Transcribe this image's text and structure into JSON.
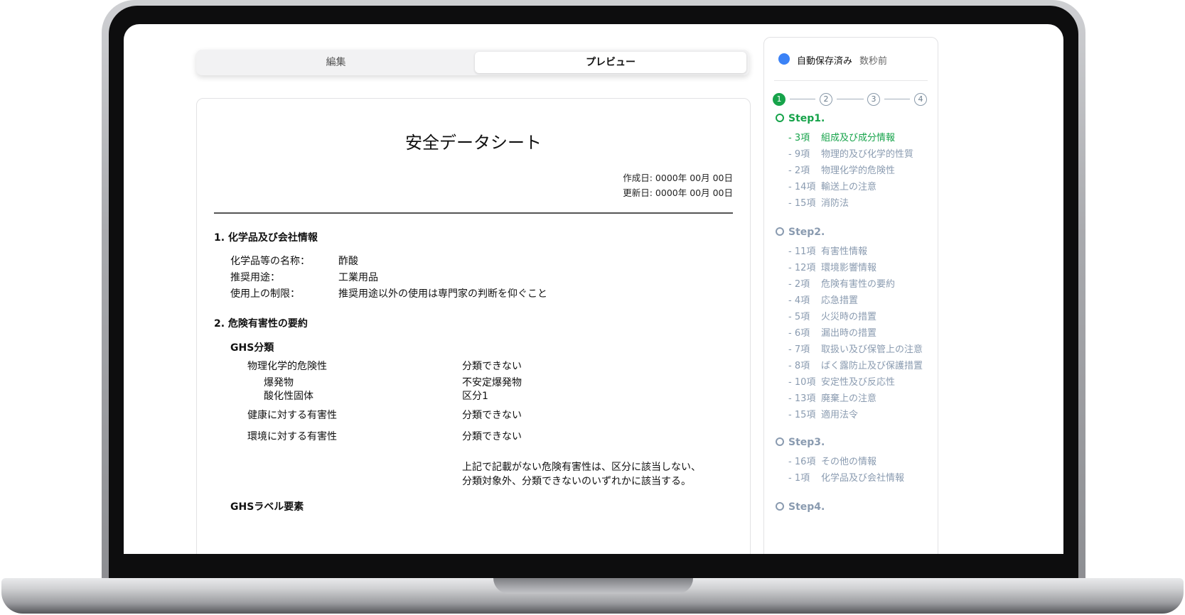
{
  "tabs": [
    {
      "label": "編集"
    },
    {
      "label": "プレビュー"
    }
  ],
  "document": {
    "title": "安全データシート",
    "created": "作成日: 0000年 00月 00日",
    "updated": "更新日: 0000年 00月 00日",
    "section1": {
      "heading": "1. 化学品及び会社情報",
      "rows": [
        {
          "label": "化学品等の名称：",
          "value": "酢酸"
        },
        {
          "label": "推奨用途：",
          "value": "工業用品"
        },
        {
          "label": "使用上の制限：",
          "value": "推奨用途以外の使用は専門家の判断を仰ぐこと"
        }
      ]
    },
    "section2": {
      "heading": "2. 危険有害性の要約",
      "ghs_heading": "GHS分類",
      "rows": [
        {
          "label": "物理化学的危険性",
          "value": "分類できない"
        },
        {
          "label": "爆発物",
          "value": "不安定爆発物"
        },
        {
          "label": "酸化性固体",
          "value": "区分1"
        },
        {
          "label": "健康に対する有害性",
          "value": "分類できない"
        },
        {
          "label": "環境に対する有害性",
          "value": "分類できない"
        }
      ],
      "note": "上記で記載がない危険有害性は、区分に該当しない、分類対象外、分類できないのいずれかに該当する。",
      "label_heading": "GHSラベル要素"
    }
  },
  "panel": {
    "autosave_label": "自動保存済み",
    "autosave_time": "数秒前",
    "stepper": [
      "1",
      "2",
      "3",
      "4"
    ],
    "steps": [
      {
        "title": "Step1.",
        "items": [
          {
            "num": "- 3項",
            "label": "組成及び成分情報"
          },
          {
            "num": "- 9項",
            "label": "物理的及び化学的性質"
          },
          {
            "num": "- 2項",
            "label": "物理化学的危険性"
          },
          {
            "num": "- 14項",
            "label": "輸送上の注意"
          },
          {
            "num": "- 15項",
            "label": "消防法"
          }
        ]
      },
      {
        "title": "Step2.",
        "items": [
          {
            "num": "- 11項",
            "label": "有害性情報"
          },
          {
            "num": "- 12項",
            "label": "環境影響情報"
          },
          {
            "num": "- 2項",
            "label": "危険有害性の要約"
          },
          {
            "num": "- 4項",
            "label": "応急措置"
          },
          {
            "num": "- 5項",
            "label": "火災時の措置"
          },
          {
            "num": "- 6項",
            "label": "漏出時の措置"
          },
          {
            "num": "- 7項",
            "label": "取扱い及び保管上の注意"
          },
          {
            "num": "- 8項",
            "label": "ばく露防止及び保護措置"
          },
          {
            "num": "- 10項",
            "label": "安定性及び反応性"
          },
          {
            "num": "- 13項",
            "label": "廃棄上の注意"
          },
          {
            "num": "- 15項",
            "label": "適用法令"
          }
        ]
      },
      {
        "title": "Step3.",
        "items": [
          {
            "num": "- 16項",
            "label": "その他の情報"
          },
          {
            "num": "- 1項",
            "label": "化学品及び会社情報"
          }
        ]
      },
      {
        "title": "Step4.",
        "items": []
      }
    ]
  },
  "colors": {
    "accent_green": "#16a34a",
    "autosave_blue": "#3b82f6",
    "muted": "#8a9bb0"
  }
}
